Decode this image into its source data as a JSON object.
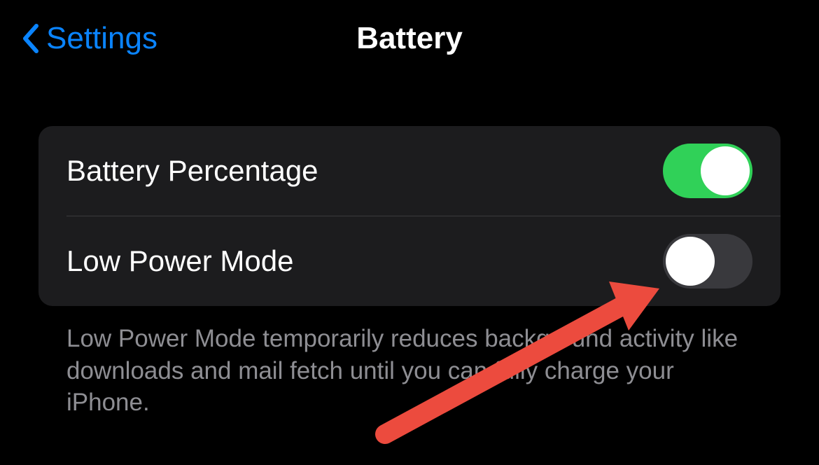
{
  "header": {
    "back_label": "Settings",
    "title": "Battery"
  },
  "rows": [
    {
      "label": "Battery Percentage",
      "toggle_on": true
    },
    {
      "label": "Low Power Mode",
      "toggle_on": false
    }
  ],
  "footer": "Low Power Mode temporarily reduces background activity like downloads and mail fetch until you can fully charge your iPhone.",
  "colors": {
    "accent_blue": "#0a84ff",
    "toggle_green": "#30d158",
    "annotation_red": "#ec4b3e"
  }
}
